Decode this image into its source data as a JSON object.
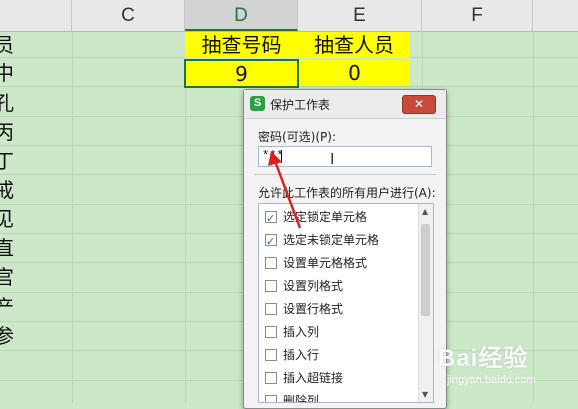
{
  "columns": [
    "C",
    "D",
    "E",
    "F"
  ],
  "cells": {
    "d_header": "抽查号码",
    "e_header": "抽查人员",
    "d_value": "9",
    "e_value": "0"
  },
  "edge_text": [
    "员",
    "中",
    "孔",
    "丙",
    "丁",
    "戒",
    "见",
    "直",
    "宫",
    "产",
    "参"
  ],
  "dialog": {
    "app_icon": "S",
    "title": "保护工作表",
    "close": "✕",
    "password_label": "密码(可选)(P):",
    "password_value": "***",
    "allow_label": "允许此工作表的所有用户进行(A):",
    "items": [
      {
        "label": "选定锁定单元格",
        "checked": true
      },
      {
        "label": "选定未锁定单元格",
        "checked": true
      },
      {
        "label": "设置单元格格式",
        "checked": false
      },
      {
        "label": "设置列格式",
        "checked": false
      },
      {
        "label": "设置行格式",
        "checked": false
      },
      {
        "label": "插入列",
        "checked": false
      },
      {
        "label": "插入行",
        "checked": false
      },
      {
        "label": "插入超链接",
        "checked": false
      },
      {
        "label": "删除列",
        "checked": false
      }
    ]
  },
  "watermark": {
    "brand": "Bai经验",
    "url": "jingyan.baidu.com"
  },
  "colors": {
    "accent": "#217346",
    "yellow": "#ffff00",
    "sheet_bg": "#cde8c9",
    "arrow": "#e02020"
  }
}
